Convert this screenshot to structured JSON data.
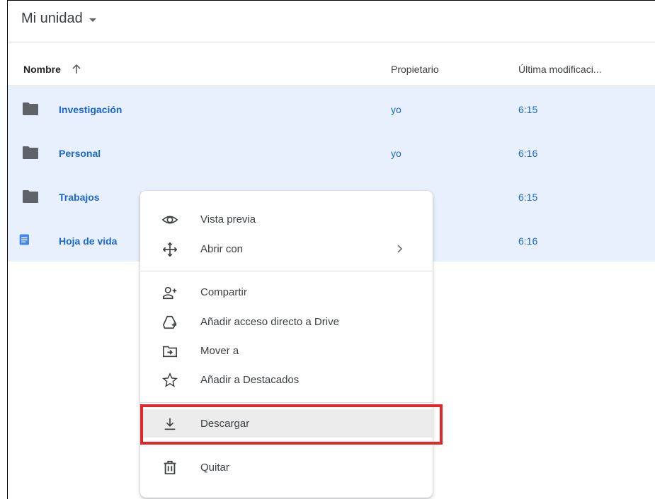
{
  "title": "Mi unidad",
  "columns": {
    "name": "Nombre",
    "owner": "Propietario",
    "modified": "Última modificaci..."
  },
  "rows": [
    {
      "icon": "folder-icon",
      "name": "Investigación",
      "owner": "yo",
      "modified": "6:15"
    },
    {
      "icon": "folder-icon",
      "name": "Personal",
      "owner": "yo",
      "modified": "6:16"
    },
    {
      "icon": "folder-icon",
      "name": "Trabajos",
      "owner": "",
      "modified": "6:15"
    },
    {
      "icon": "google-doc-icon",
      "name": "Hoja de vida",
      "owner": "",
      "modified": "6:16"
    }
  ],
  "context_menu": {
    "items": [
      {
        "icon": "eye-icon",
        "label": "Vista previa"
      },
      {
        "icon": "move-arrows-icon",
        "label": "Abrir con",
        "submenu": true
      },
      {
        "icon": "add-person-icon",
        "label": "Compartir"
      },
      {
        "icon": "drive-shortcut-icon",
        "label": "Añadir acceso directo a Drive"
      },
      {
        "icon": "move-folder-icon",
        "label": "Mover a"
      },
      {
        "icon": "star-icon",
        "label": "Añadir a Destacados"
      },
      {
        "icon": "download-icon",
        "label": "Descargar",
        "highlighted": true
      },
      {
        "icon": "trash-icon",
        "label": "Quitar"
      }
    ]
  },
  "colors": {
    "selection": "#e8f0fe",
    "link": "#1967d2",
    "highlight_border": "#e4262a"
  }
}
